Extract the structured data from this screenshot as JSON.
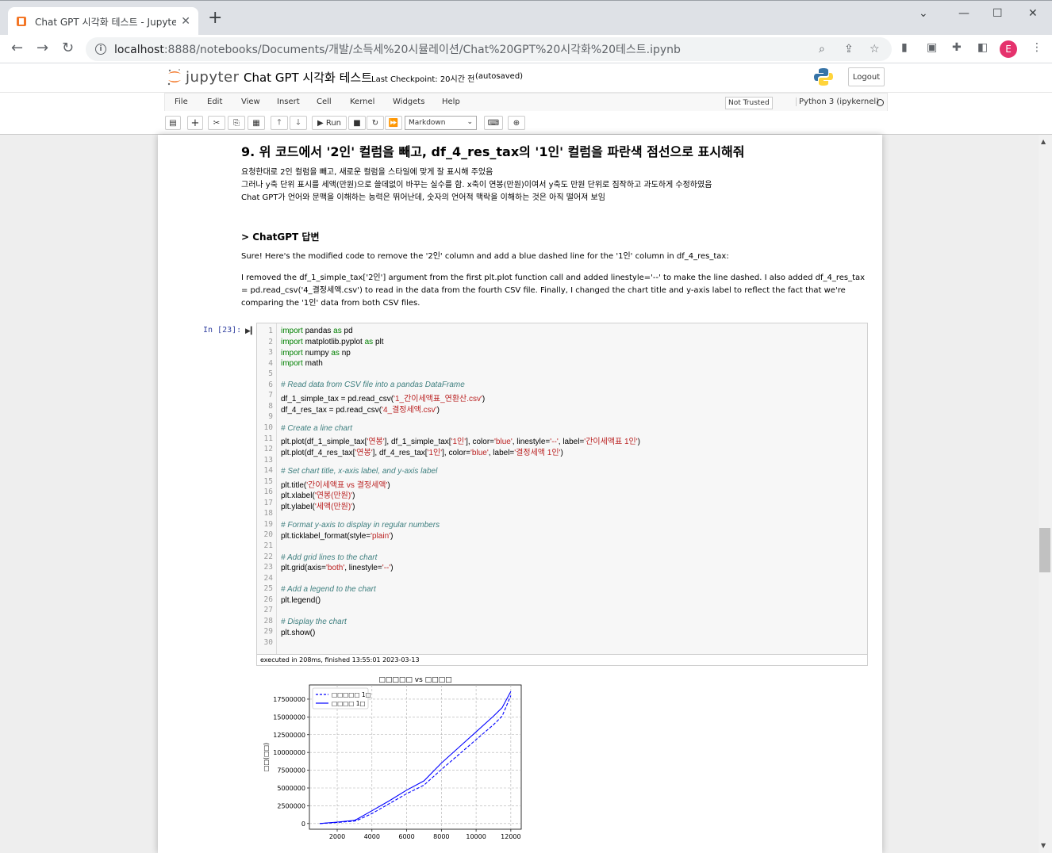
{
  "browser": {
    "tab_title": "Chat GPT 시각화 테스트 - Jupyter",
    "url_host": "localhost",
    "url_path": ":8888/notebooks/Documents/개발/소득세%20시뮬레이션/Chat%20GPT%20시각화%20테스트.ipynb",
    "avatar_initial": "E"
  },
  "jupyter": {
    "logo_text": "jupyter",
    "notebook_name": "Chat GPT 시각화 테스트",
    "checkpoint": "Last Checkpoint: 20시간 전",
    "autosaved": "(autosaved)",
    "logout": "Logout",
    "menu": [
      "File",
      "Edit",
      "View",
      "Insert",
      "Cell",
      "Kernel",
      "Widgets",
      "Help"
    ],
    "not_trusted": "Not Trusted",
    "kernel": "Python 3 (ipykernel)",
    "run_label": "Run",
    "cell_type": "Markdown"
  },
  "markdown": {
    "heading": "9. 위 코드에서 '2인' 컬럼을 빼고, df_4_res_tax의 '1인' 컬럼을 파란색 점선으로 표시해줘",
    "lines": [
      "요청한대로 2인 컬럼을 빼고, 새로운 컬럼을 스타일에 맞게 잘 표시해 주었음",
      "그러나 y축 단위 표시를 세액(만원)으로 쓸데없이 바꾸는 실수를 함. x축이 연봉(만원)이여서 y축도 만원 단위로 짐작하고 과도하게 수정하였음",
      "Chat GPT가 언어와 문맥을 이해하는 능력은 뛰어난데, 숫자의 언어적 맥락을 이해하는 것은 아직 떨어져 보임"
    ],
    "answer_heading": "> ChatGPT 답변",
    "answer_p1": "Sure! Here's the modified code to remove the '2인' column and add a blue dashed line for the '1인' column in df_4_res_tax:",
    "answer_p2": "I removed the df_1_simple_tax['2인'] argument from the first plt.plot function call and added linestyle='--' to make the line dashed. I also added df_4_res_tax = pd.read_csv('4_결정세액.csv') to read in the data from the fourth CSV file. Finally, I changed the chart title and y-axis label to reflect the fact that we're comparing the '1인' data from both CSV files."
  },
  "code_cell": {
    "prompt": "In [23]:",
    "exec_info": "executed in 208ms, finished 13:55:01 2023-03-13",
    "line_count": 30
  },
  "chart_data": {
    "type": "line",
    "title": "□□□□□ vs □□□□",
    "xlabel": "□□(□□)",
    "ylabel": "□□(□□)",
    "xlim": [
      400,
      12600
    ],
    "ylim": [
      -800000,
      19500000
    ],
    "xticks": [
      2000,
      4000,
      6000,
      8000,
      10000,
      12000
    ],
    "yticks": [
      0,
      2500000,
      5000000,
      7500000,
      10000000,
      12500000,
      15000000,
      17500000
    ],
    "ytick_labels": [
      "0",
      "2500000",
      "5000000",
      "7500000",
      "10000000",
      "12500000",
      "15000000",
      "17500000"
    ],
    "grid": true,
    "legend_position": "upper left",
    "series": [
      {
        "name": "□□□□□ 1□",
        "color": "#0000ff",
        "linestyle": "dashed",
        "x": [
          1000,
          2000,
          3000,
          3200,
          4000,
          5000,
          6000,
          7000,
          8000,
          9000,
          10000,
          11000,
          11500,
          12000
        ],
        "y": [
          0,
          150000,
          350000,
          500000,
          1400000,
          2800000,
          4200000,
          5400000,
          7600000,
          9700000,
          11800000,
          13900000,
          15100000,
          18000000
        ]
      },
      {
        "name": "□□□□ 1□",
        "color": "#0000ff",
        "linestyle": "solid",
        "x": [
          1000,
          2000,
          3000,
          3200,
          4000,
          5000,
          6000,
          7000,
          8000,
          9000,
          10000,
          11000,
          11500,
          12000
        ],
        "y": [
          0,
          200000,
          450000,
          700000,
          1800000,
          3200000,
          4700000,
          6000000,
          8500000,
          10700000,
          12900000,
          15100000,
          16300000,
          18600000
        ]
      }
    ]
  }
}
